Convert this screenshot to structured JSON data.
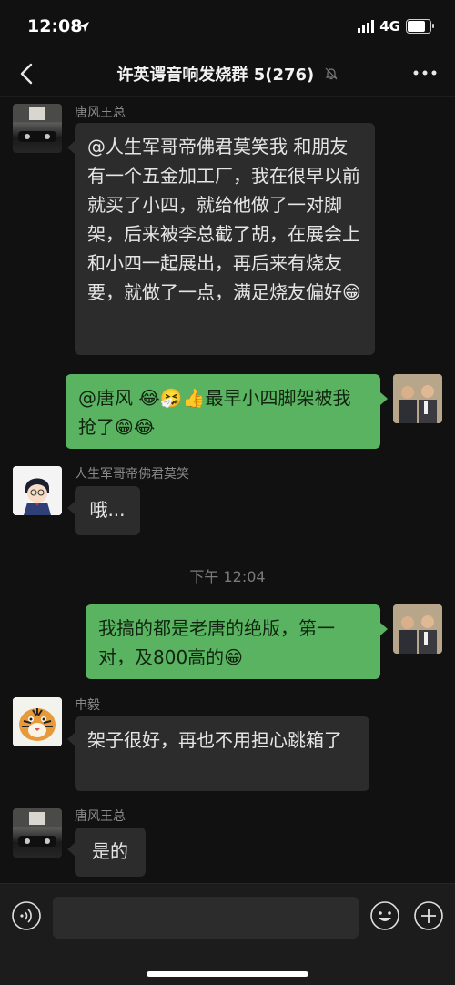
{
  "status": {
    "time": "12:08",
    "network": "4G",
    "battery_level": 0.8
  },
  "nav": {
    "title": "许英谔音响发烧群 5(276)",
    "back_icon": "chevron-left-icon",
    "mute_icon": "bell-slash-icon",
    "more_icon": "more-dots-icon"
  },
  "messages": [
    {
      "sender": "唐风王总",
      "direction": "in",
      "text": "@人生军哥帝佛君莫笑我 和朋友有一个五金加工厂，我在很早以前就买了小四，就给他做了一对脚架，后来被李总截了胡，在展会上和小四一起展出，再后来有烧友要，就做了一点，满足烧友偏好😁"
    },
    {
      "direction": "out",
      "text": "@唐风 😂🤧👍最早小四脚架被我抢了😁😂"
    },
    {
      "sender": "人生军哥帝佛君莫笑",
      "direction": "in",
      "text": "哦..."
    },
    {
      "direction": "out",
      "text": "我搞的都是老唐的绝版，第一对，及800高的😁"
    },
    {
      "sender": "申毅",
      "direction": "in",
      "text": "架子很好，再也不用担心跳箱了"
    },
    {
      "sender": "唐风王总",
      "direction": "in",
      "text": "是的"
    }
  ],
  "timestamp": "下午 12:04",
  "input_bar": {
    "voice_icon": "voice-icon",
    "emoji_icon": "smiley-icon",
    "plus_icon": "plus-circle-icon"
  },
  "colors": {
    "background": "#111111",
    "bubble_in": "#2c2c2c",
    "bubble_out": "#5ab361"
  }
}
